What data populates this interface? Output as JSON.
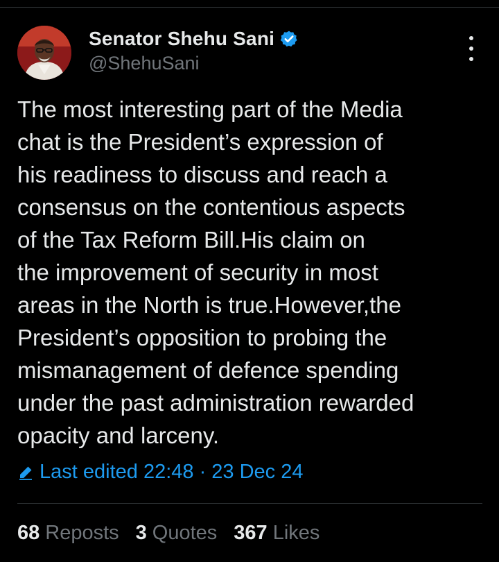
{
  "author": {
    "name": "Senator Shehu Sani",
    "handle": "@ShehuSani"
  },
  "tweet": {
    "lines": [
      "The most interesting part of the Media",
      "chat is the President’s expression of",
      "his readiness to discuss and reach a",
      "consensus on the contentious aspects",
      "of the Tax Reform Bill.His claim on",
      "the improvement of security in most",
      "areas in the North is true.However,the",
      "President’s opposition to probing the",
      "mismanagement of defence spending",
      "under the past administration rewarded",
      "opacity and larceny."
    ]
  },
  "edited": {
    "label": "Last edited 22:48 · 23 Dec 24"
  },
  "stats": {
    "reposts": {
      "count": "68",
      "label": "Reposts"
    },
    "quotes": {
      "count": "3",
      "label": "Quotes"
    },
    "likes": {
      "count": "367",
      "label": "Likes"
    }
  },
  "icons": {
    "verified": "verified-badge-icon",
    "more": "more-options-icon",
    "edited": "pencil-icon"
  },
  "colors": {
    "background": "#000000",
    "text": "#e7e9ea",
    "muted": "#71767b",
    "accent": "#1d9bf0"
  }
}
